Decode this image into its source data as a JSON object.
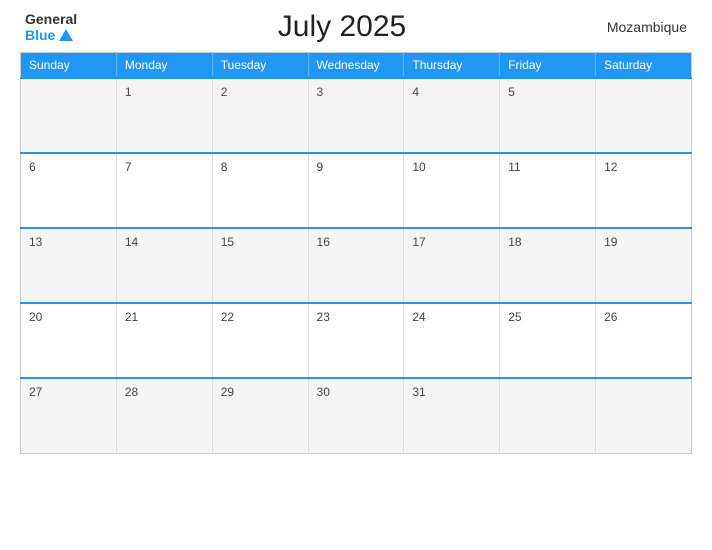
{
  "header": {
    "logo_general": "General",
    "logo_blue": "Blue",
    "title": "July 2025",
    "country": "Mozambique"
  },
  "calendar": {
    "days_of_week": [
      "Sunday",
      "Monday",
      "Tuesday",
      "Wednesday",
      "Thursday",
      "Friday",
      "Saturday"
    ],
    "weeks": [
      [
        "",
        "1",
        "2",
        "3",
        "4",
        "5"
      ],
      [
        "6",
        "7",
        "8",
        "9",
        "10",
        "11",
        "12"
      ],
      [
        "13",
        "14",
        "15",
        "16",
        "17",
        "18",
        "19"
      ],
      [
        "20",
        "21",
        "22",
        "23",
        "24",
        "25",
        "26"
      ],
      [
        "27",
        "28",
        "29",
        "30",
        "31",
        "",
        ""
      ]
    ]
  }
}
